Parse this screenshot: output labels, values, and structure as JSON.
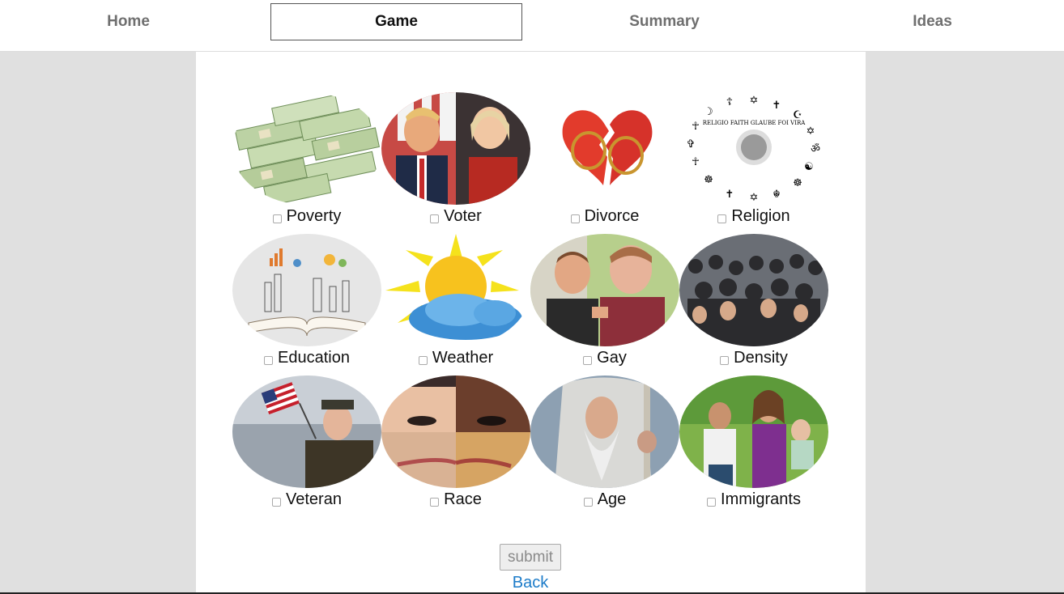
{
  "nav": {
    "tabs": [
      {
        "label": "Home"
      },
      {
        "label": "Game"
      },
      {
        "label": "Summary"
      },
      {
        "label": "Ideas"
      }
    ],
    "active_tab": "Game"
  },
  "grid": {
    "items": [
      {
        "label": "Poverty",
        "image": "money-stacks",
        "checked": false
      },
      {
        "label": "Voter",
        "image": "candidates",
        "checked": false
      },
      {
        "label": "Divorce",
        "image": "broken-heart-rings",
        "checked": false
      },
      {
        "label": "Religion",
        "image": "religious-symbols",
        "checked": false
      },
      {
        "label": "Education",
        "image": "open-book-graphics",
        "checked": false
      },
      {
        "label": "Weather",
        "image": "sun-cloud",
        "checked": false
      },
      {
        "label": "Gay",
        "image": "couple",
        "checked": false
      },
      {
        "label": "Density",
        "image": "crowd",
        "checked": false
      },
      {
        "label": "Veteran",
        "image": "veteran-flag",
        "checked": false
      },
      {
        "label": "Race",
        "image": "face-collage",
        "checked": false
      },
      {
        "label": "Age",
        "image": "old-wizard",
        "checked": false
      },
      {
        "label": "Immigrants",
        "image": "family",
        "checked": false
      }
    ]
  },
  "religion_image_text": "RELIGIO FAITH GLAUBE FOI VIRA",
  "actions": {
    "submit_label": "submit",
    "back_label": "Back"
  },
  "colors": {
    "link": "#1d7cc9",
    "page_bg": "#e0e0e0",
    "panel_bg": "#ffffff"
  }
}
